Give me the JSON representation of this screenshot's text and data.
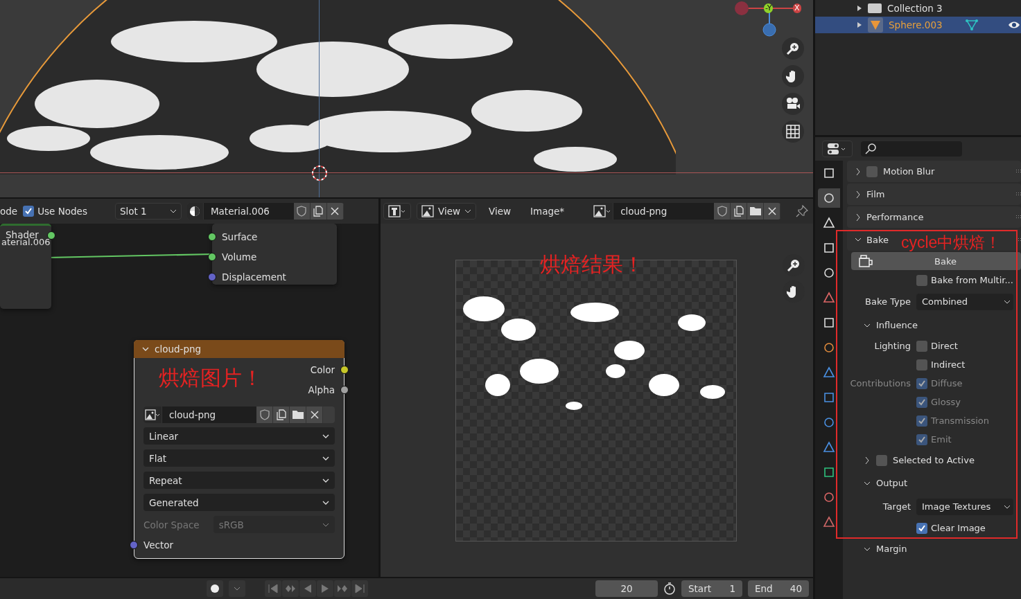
{
  "viewport": {
    "gizmo_labels": [
      "-Y",
      "X"
    ]
  },
  "outliner": {
    "rows": [
      {
        "label": "Collection 3",
        "selected": false
      },
      {
        "label": "Sphere.003",
        "selected": true
      }
    ]
  },
  "node_editor": {
    "header": {
      "editor_label": "ode",
      "use_nodes": {
        "label": "Use Nodes",
        "checked": true
      },
      "slot": "Slot 1",
      "material": "Material.006"
    },
    "nodes": [
      {
        "kind": "partial",
        "outputs": [
          {
            "label": "Shader",
            "color": "#63c763"
          }
        ],
        "subtitle": "aterial.006"
      },
      {
        "kind": "output",
        "inputs": [
          {
            "label": "Surface",
            "color": "#63c763"
          },
          {
            "label": "Volume",
            "color": "#63c763"
          },
          {
            "label": "Displacement",
            "color": "#6363c7"
          }
        ]
      },
      {
        "kind": "image_texture",
        "title": "cloud-png",
        "outputs": [
          {
            "label": "Color",
            "color": "#c7c729"
          },
          {
            "label": "Alpha",
            "color": "#a1a1a1"
          }
        ],
        "image": "cloud-png",
        "options": [
          "Linear",
          "Flat",
          "Repeat",
          "Generated"
        ],
        "color_space": {
          "label": "Color Space",
          "value": "sRGB",
          "disabled": true
        },
        "inputs": [
          {
            "label": "Vector",
            "color": "#6363c7"
          }
        ]
      }
    ],
    "annotation": "烘焙图片！"
  },
  "image_editor": {
    "header": {
      "mode": "View",
      "menus": [
        "View",
        "Image*"
      ],
      "image": "cloud-png"
    },
    "annotation": "烘焙结果！"
  },
  "properties": {
    "tabs": [
      {
        "selected": false
      },
      {
        "selected": true
      },
      {
        "selected": false
      },
      {
        "selected": false
      },
      {
        "selected": false
      },
      {
        "selected": false
      },
      {
        "selected": false
      },
      {
        "selected": false
      },
      {
        "selected": false
      },
      {
        "selected": false
      },
      {
        "selected": false
      },
      {
        "selected": false
      },
      {
        "selected": false
      },
      {
        "selected": false
      },
      {
        "selected": false
      }
    ],
    "items": [
      {
        "kind": "panel",
        "label": "Motion Blur",
        "expanded": false,
        "checked": false
      },
      {
        "kind": "panel",
        "label": "Film",
        "expanded": false
      },
      {
        "kind": "panel",
        "label": "Performance",
        "expanded": false
      },
      {
        "kind": "panel",
        "label": "Bake",
        "expanded": true
      },
      {
        "kind": "button",
        "label": "Bake"
      },
      {
        "kind": "checkbox",
        "label": "Bake from Multir...",
        "checked": false,
        "disabled": false
      },
      {
        "kind": "select",
        "label": "Bake Type",
        "value": "Combined"
      },
      {
        "kind": "subpanel",
        "label": "Influence",
        "expanded": true
      },
      {
        "kind": "checkbox",
        "group_label": "Lighting",
        "label": "Direct",
        "checked": false,
        "disabled": false
      },
      {
        "kind": "checkbox",
        "label": "Indirect",
        "checked": false,
        "disabled": false
      },
      {
        "kind": "checkbox",
        "group_label": "Contributions",
        "label": "Diffuse",
        "checked": true,
        "disabled": true
      },
      {
        "kind": "checkbox",
        "label": "Glossy",
        "checked": true,
        "disabled": true
      },
      {
        "kind": "checkbox",
        "label": "Transmission",
        "checked": true,
        "disabled": true
      },
      {
        "kind": "checkbox",
        "label": "Emit",
        "checked": true,
        "disabled": true
      },
      {
        "kind": "subpanel",
        "label": "Selected to Active",
        "expanded": false,
        "checked": false
      },
      {
        "kind": "subpanel",
        "label": "Output",
        "expanded": true
      },
      {
        "kind": "select",
        "label": "Target",
        "value": "Image Textures"
      },
      {
        "kind": "checkbox",
        "label": "Clear Image",
        "checked": true,
        "disabled": false
      },
      {
        "kind": "subpanel",
        "label": "Margin",
        "expanded": true
      }
    ],
    "annotation": "cycle中烘焙！"
  },
  "timeline": {
    "current_frame": "20",
    "start_label": "Start",
    "start": "1",
    "end_label": "End",
    "end": "40"
  }
}
